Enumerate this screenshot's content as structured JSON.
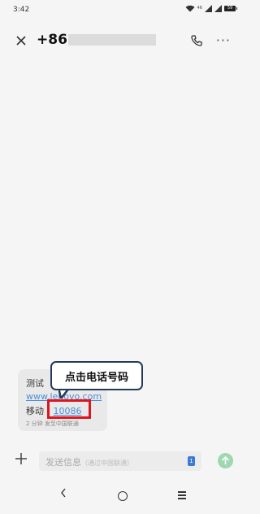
{
  "status_bar": {
    "time": "3:42",
    "network": "46",
    "battery": "59"
  },
  "header": {
    "contact_visible": "+86",
    "more_label": "···"
  },
  "message": {
    "line1": "测试",
    "link": "www.lenovo.com",
    "line3_prefix": "移动",
    "phone_number": "10086",
    "meta": "2 分钟  发至中国联通"
  },
  "callout": {
    "text": "点击电话号码"
  },
  "composer": {
    "placeholder": "发送信息",
    "placeholder_sub": "（通过中国联通）",
    "sim_badge": "1"
  }
}
